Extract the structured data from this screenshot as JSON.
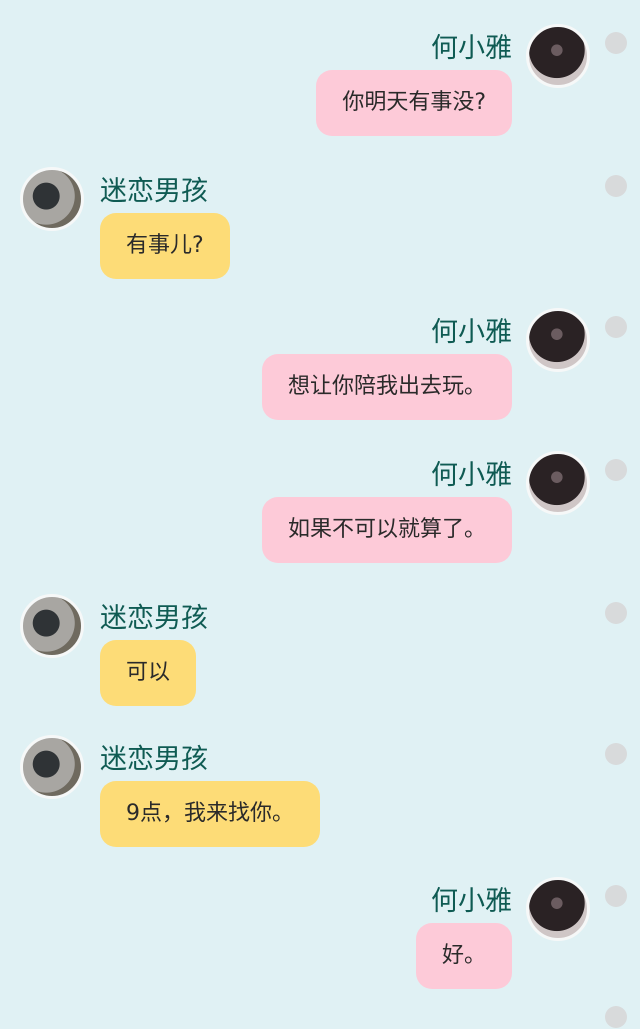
{
  "messages": [
    {
      "side": "right",
      "sender": "何小雅",
      "text": "你明天有事没?"
    },
    {
      "side": "left",
      "sender": "迷恋男孩",
      "text": "有事儿?"
    },
    {
      "side": "right",
      "sender": "何小雅",
      "text": "想让你陪我出去玩。"
    },
    {
      "side": "right",
      "sender": "何小雅",
      "text": "如果不可以就算了。"
    },
    {
      "side": "left",
      "sender": "迷恋男孩",
      "text": "可以"
    },
    {
      "side": "left",
      "sender": "迷恋男孩",
      "text": "9点，我来找你。"
    },
    {
      "side": "right",
      "sender": "何小雅",
      "text": "好。"
    }
  ],
  "colors": {
    "background": "#e0f1f4",
    "right_bubble": "#fdcad8",
    "left_bubble": "#fddc77",
    "name_text": "#0f5b53"
  }
}
